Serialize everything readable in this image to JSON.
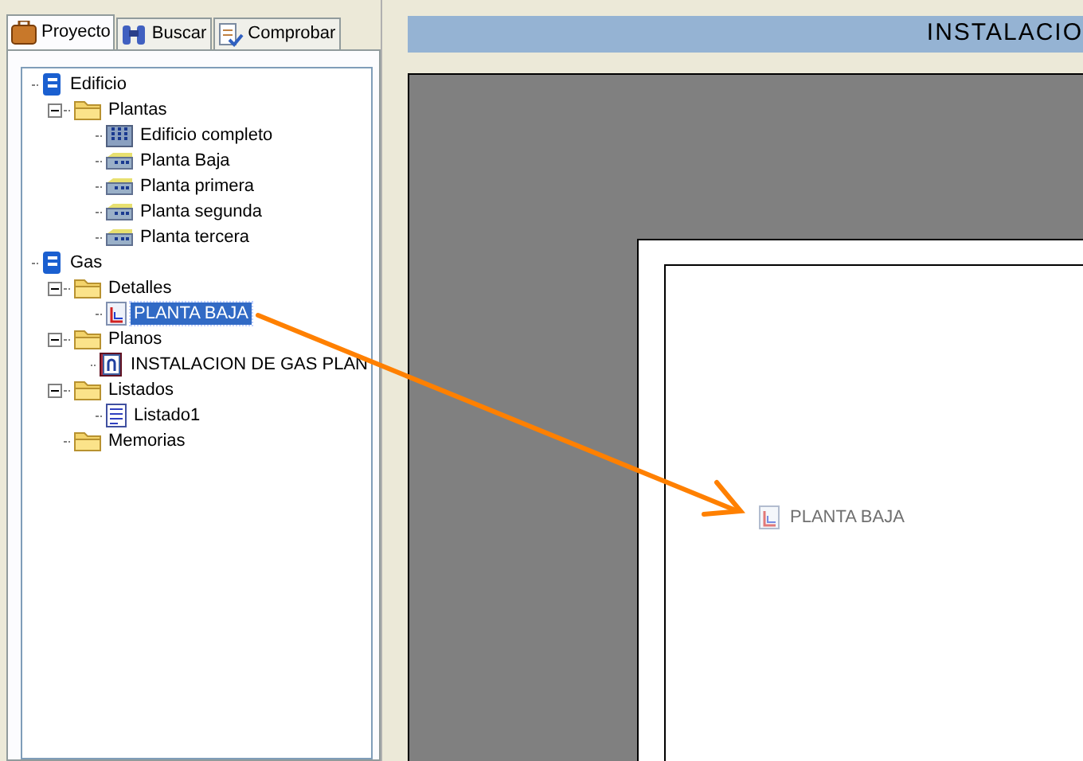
{
  "tabs": [
    {
      "label": "Proyecto",
      "kind": "briefcase",
      "selected": true
    },
    {
      "label": "Buscar",
      "kind": "binoculars",
      "selected": false
    },
    {
      "label": "Comprobar",
      "kind": "check",
      "selected": false
    }
  ],
  "tree": [
    {
      "label": "Edificio",
      "kind": "database",
      "selected": false,
      "children": [
        {
          "label": "Plantas",
          "kind": "folder",
          "selected": false,
          "expanded": true,
          "children": [
            {
              "label": "Edificio completo",
              "kind": "building",
              "selected": false
            },
            {
              "label": "Planta Baja",
              "kind": "floor",
              "selected": false
            },
            {
              "label": "Planta primera",
              "kind": "floor",
              "selected": false
            },
            {
              "label": "Planta segunda",
              "kind": "floor",
              "selected": false
            },
            {
              "label": "Planta tercera",
              "kind": "floor",
              "selected": false
            }
          ]
        }
      ]
    },
    {
      "label": "Gas",
      "kind": "database",
      "selected": false,
      "children": [
        {
          "label": "Detalles",
          "kind": "folder",
          "selected": false,
          "expanded": true,
          "children": [
            {
              "label": "PLANTA BAJA",
              "kind": "detail",
              "selected": true
            }
          ]
        },
        {
          "label": "Planos",
          "kind": "folder",
          "selected": false,
          "expanded": true,
          "children": [
            {
              "label": "INSTALACION DE GAS  PLAN",
              "kind": "plan",
              "selected": false
            }
          ]
        },
        {
          "label": "Listados",
          "kind": "folder",
          "selected": false,
          "expanded": true,
          "children": [
            {
              "label": "Listado1",
              "kind": "list",
              "selected": false
            }
          ]
        },
        {
          "label": "Memorias",
          "kind": "folder",
          "selected": false
        }
      ]
    }
  ],
  "header": {
    "title": "INSTALACIO"
  },
  "canvas_item": {
    "label": "PLANTA BAJA"
  }
}
